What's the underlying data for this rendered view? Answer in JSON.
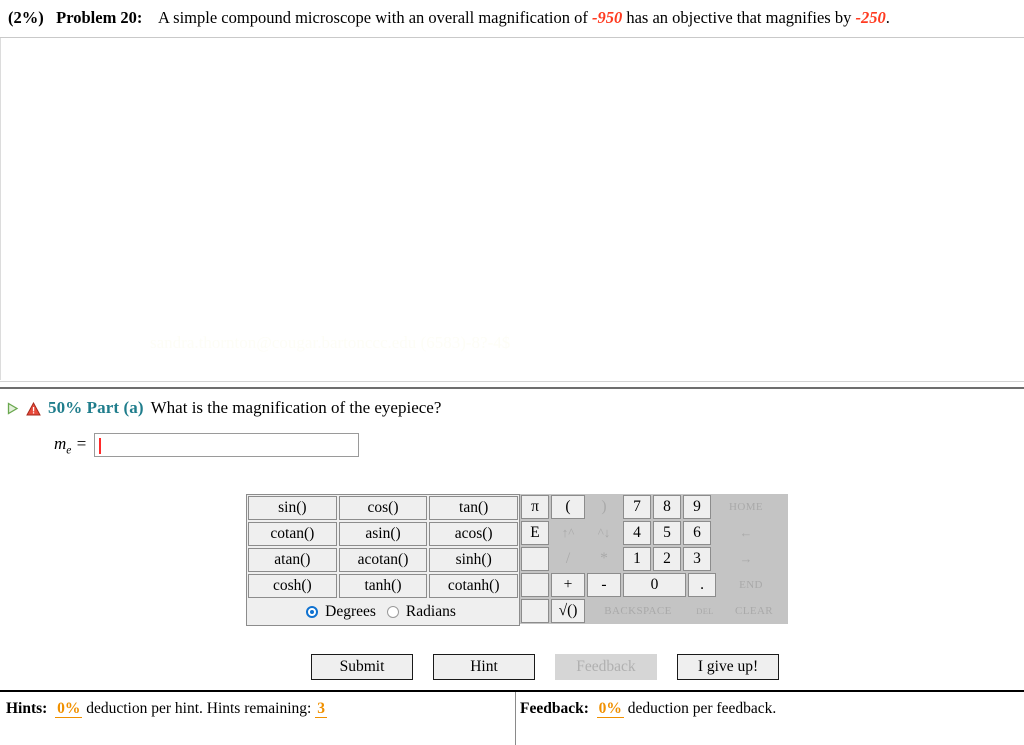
{
  "problem": {
    "weight": "(2%)",
    "number": "Problem 20:",
    "text_part1": "A simple compound microscope with an overall magnification of ",
    "overall_magnification": "-950",
    "text_part2": " has an objective that magnifies by ",
    "objective_magnification": "-250",
    "text_part3": "."
  },
  "watermark": "sandra.thornton@cougar.bartonccc.edu (6583)-8?-4$",
  "part": {
    "play_icon": "play-triangle-icon",
    "warning_icon": "warning-triangle-icon",
    "label": "50% Part (a)",
    "question": "What is the magnification of the eyepiece?",
    "accent_color": "#1f7d8c"
  },
  "answer": {
    "variable": "m",
    "subscript": "e",
    "equals": "=",
    "value": "",
    "caret_color": "#ff2a2a"
  },
  "calculator": {
    "functions": [
      [
        "sin()",
        "cos()",
        "tan()"
      ],
      [
        "cotan()",
        "asin()",
        "acos()"
      ],
      [
        "atan()",
        "acotan()",
        "sinh()"
      ],
      [
        "cosh()",
        "tanh()",
        "cotanh()"
      ]
    ],
    "angle_mode": {
      "selected": "Degrees",
      "options": [
        "Degrees",
        "Radians"
      ]
    },
    "keypad": [
      [
        {
          "label": "π",
          "width": "w-sm",
          "disabled": false,
          "style": ""
        },
        {
          "label": "(",
          "width": "w-md",
          "disabled": false,
          "style": ""
        },
        {
          "label": ")",
          "width": "w-md",
          "disabled": true,
          "style": ""
        },
        {
          "label": "7",
          "width": "w-sm",
          "disabled": false,
          "style": ""
        },
        {
          "label": "8",
          "width": "w-sm",
          "disabled": false,
          "style": ""
        },
        {
          "label": "9",
          "width": "w-sm",
          "disabled": false,
          "style": ""
        },
        {
          "label": "HOME",
          "width": "w-nav",
          "disabled": true,
          "style": "key-small"
        }
      ],
      [
        {
          "label": "E",
          "width": "w-sm",
          "disabled": false,
          "style": ""
        },
        {
          "label": "↑^",
          "width": "w-md",
          "disabled": true,
          "style": "key-arrow"
        },
        {
          "label": "^↓",
          "width": "w-md",
          "disabled": true,
          "style": "key-arrow"
        },
        {
          "label": "4",
          "width": "w-sm",
          "disabled": false,
          "style": ""
        },
        {
          "label": "5",
          "width": "w-sm",
          "disabled": false,
          "style": ""
        },
        {
          "label": "6",
          "width": "w-sm",
          "disabled": false,
          "style": ""
        },
        {
          "label": "←",
          "width": "w-nav",
          "disabled": true,
          "style": "key-arrow"
        }
      ],
      [
        {
          "label": "",
          "width": "w-sm",
          "disabled": false,
          "style": "blank"
        },
        {
          "label": "/",
          "width": "w-md",
          "disabled": true,
          "style": ""
        },
        {
          "label": "*",
          "width": "w-md",
          "disabled": true,
          "style": ""
        },
        {
          "label": "1",
          "width": "w-sm",
          "disabled": false,
          "style": ""
        },
        {
          "label": "2",
          "width": "w-sm",
          "disabled": false,
          "style": ""
        },
        {
          "label": "3",
          "width": "w-sm",
          "disabled": false,
          "style": ""
        },
        {
          "label": "→",
          "width": "w-nav",
          "disabled": true,
          "style": "key-arrow"
        }
      ],
      [
        {
          "label": "",
          "width": "w-sm",
          "disabled": false,
          "style": "blank"
        },
        {
          "label": "+",
          "width": "w-md",
          "disabled": false,
          "style": ""
        },
        {
          "label": "-",
          "width": "w-md",
          "disabled": false,
          "style": ""
        },
        {
          "label": "0",
          "width": "w-zero",
          "disabled": false,
          "style": ""
        },
        {
          "label": ".",
          "width": "w-sm",
          "disabled": false,
          "style": ""
        },
        {
          "label": "END",
          "width": "w-nav",
          "disabled": true,
          "style": "key-small"
        }
      ],
      [
        {
          "label": "",
          "width": "w-sm",
          "disabled": false,
          "style": "blank"
        },
        {
          "label": "√()",
          "width": "w-md",
          "disabled": false,
          "style": ""
        },
        {
          "label": "BACKSPACE",
          "width": "w-back",
          "disabled": true,
          "style": "key-small"
        },
        {
          "label": "DEL",
          "width": "w-del",
          "disabled": true,
          "style": "key-tiny"
        },
        {
          "label": "CLEAR",
          "width": "w-nav",
          "disabled": true,
          "style": "key-small"
        }
      ]
    ]
  },
  "actions": [
    {
      "label": "Submit",
      "disabled": false
    },
    {
      "label": "Hint",
      "disabled": false
    },
    {
      "label": "Feedback",
      "disabled": true
    },
    {
      "label": "I give up!",
      "disabled": false
    }
  ],
  "footer": {
    "hints_label": "Hints:",
    "hints_deduction": "0%",
    "hints_text_mid": " deduction per hint. Hints remaining: ",
    "hints_remaining": "3",
    "feedback_label": "Feedback:",
    "feedback_deduction": "0%",
    "feedback_text_mid": " deduction per feedback.",
    "value_color": "#f09000"
  }
}
